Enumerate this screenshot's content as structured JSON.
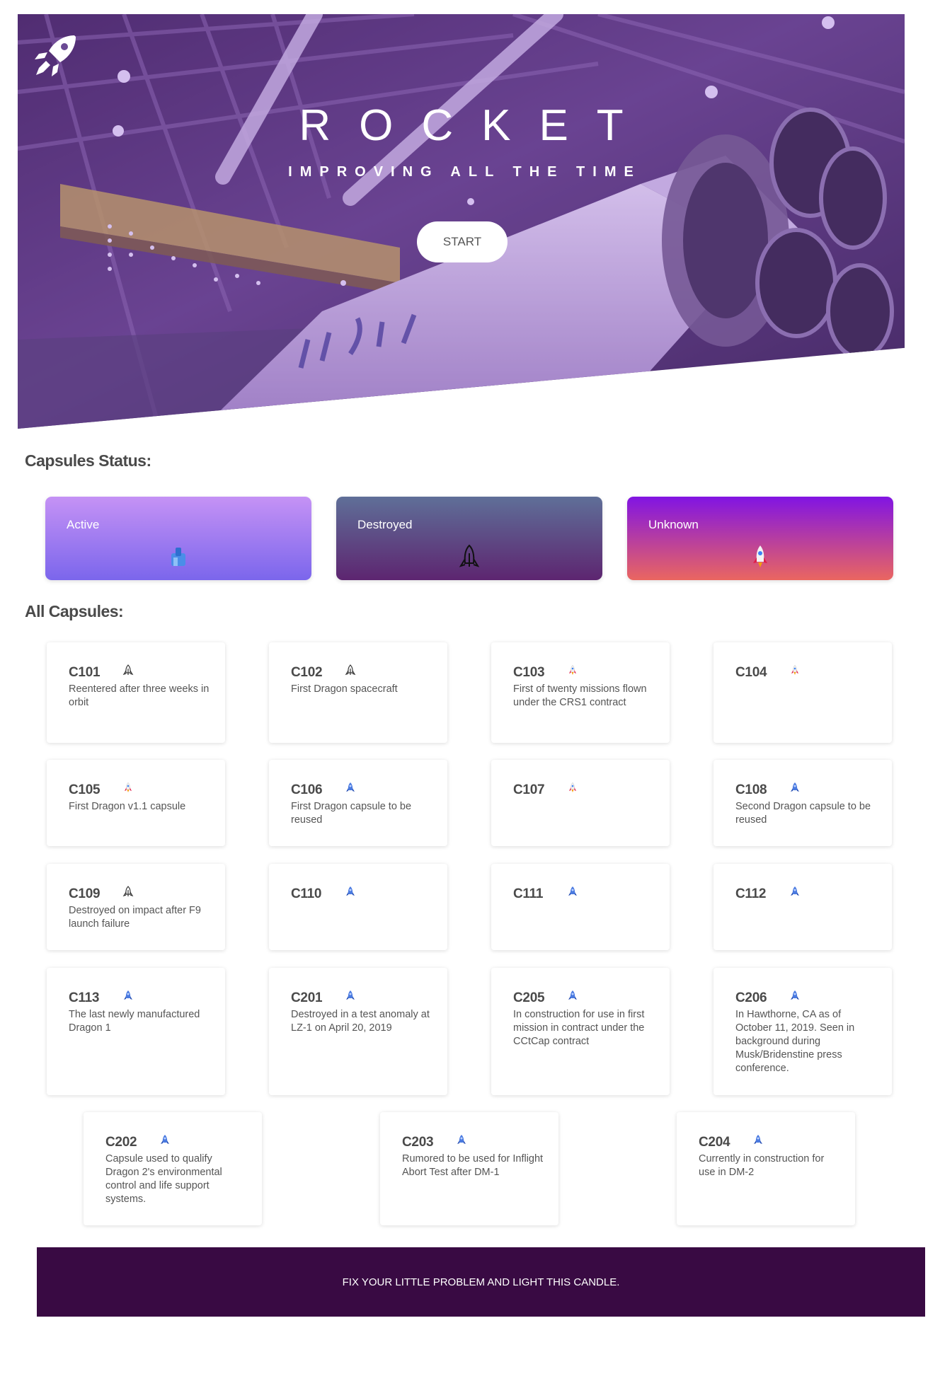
{
  "hero": {
    "title": "ROCKET",
    "subtitle": "IMPROVING ALL THE TIME",
    "start_label": "START",
    "logo_icon": "rocket-icon"
  },
  "status_section": {
    "title": "Capsules Status:",
    "cards": [
      {
        "label": "Active",
        "icon": "capsule-active-icon",
        "color_top": "#c592f5",
        "color_bottom": "#7b66ec"
      },
      {
        "label": "Destroyed",
        "icon": "rocket-outline-icon",
        "color_top": "#5f6f98",
        "color_bottom": "#5d2570"
      },
      {
        "label": "Unknown",
        "icon": "rocket-color-icon",
        "color_top": "#8114e3",
        "color_bottom": "#ea6660"
      }
    ]
  },
  "capsules_section": {
    "title": "All Capsules:",
    "capsules": [
      {
        "serial": "C101",
        "status": "destroyed",
        "details": "Reentered after three weeks in orbit"
      },
      {
        "serial": "C102",
        "status": "destroyed",
        "details": "First Dragon spacecraft"
      },
      {
        "serial": "C103",
        "status": "unknown",
        "details": "First of twenty missions flown under the CRS1 contract"
      },
      {
        "serial": "C104",
        "status": "unknown",
        "details": ""
      },
      {
        "serial": "C105",
        "status": "unknown",
        "details": "First Dragon v1.1 capsule"
      },
      {
        "serial": "C106",
        "status": "active",
        "details": "First Dragon capsule to be reused"
      },
      {
        "serial": "C107",
        "status": "unknown",
        "details": ""
      },
      {
        "serial": "C108",
        "status": "active",
        "details": "Second Dragon capsule to be reused"
      },
      {
        "serial": "C109",
        "status": "destroyed",
        "details": "Destroyed on impact after F9 launch failure"
      },
      {
        "serial": "C110",
        "status": "active",
        "details": ""
      },
      {
        "serial": "C111",
        "status": "active",
        "details": ""
      },
      {
        "serial": "C112",
        "status": "active",
        "details": ""
      },
      {
        "serial": "C113",
        "status": "active",
        "details": "The last newly manufactured Dragon 1"
      },
      {
        "serial": "C201",
        "status": "active",
        "details": "Destroyed in a test anomaly at LZ-1 on April 20, 2019"
      },
      {
        "serial": "C205",
        "status": "active",
        "details": "In construction for use in first mission in contract under the CCtCap contract"
      },
      {
        "serial": "C206",
        "status": "active",
        "details": "In Hawthorne, CA as of October 11, 2019. Seen in background during Musk/Bridenstine press conference."
      },
      {
        "serial": "C202",
        "status": "active",
        "details": "Capsule used to qualify Dragon 2's environmental control and life support systems."
      },
      {
        "serial": "C203",
        "status": "active",
        "details": "Rumored to be used for Inflight Abort Test after DM-1"
      },
      {
        "serial": "C204",
        "status": "active",
        "details": "Currently in construction for use in DM-2"
      }
    ]
  },
  "footer": {
    "text": "FIX YOUR LITTLE PROBLEM AND LIGHT THIS CANDLE."
  }
}
